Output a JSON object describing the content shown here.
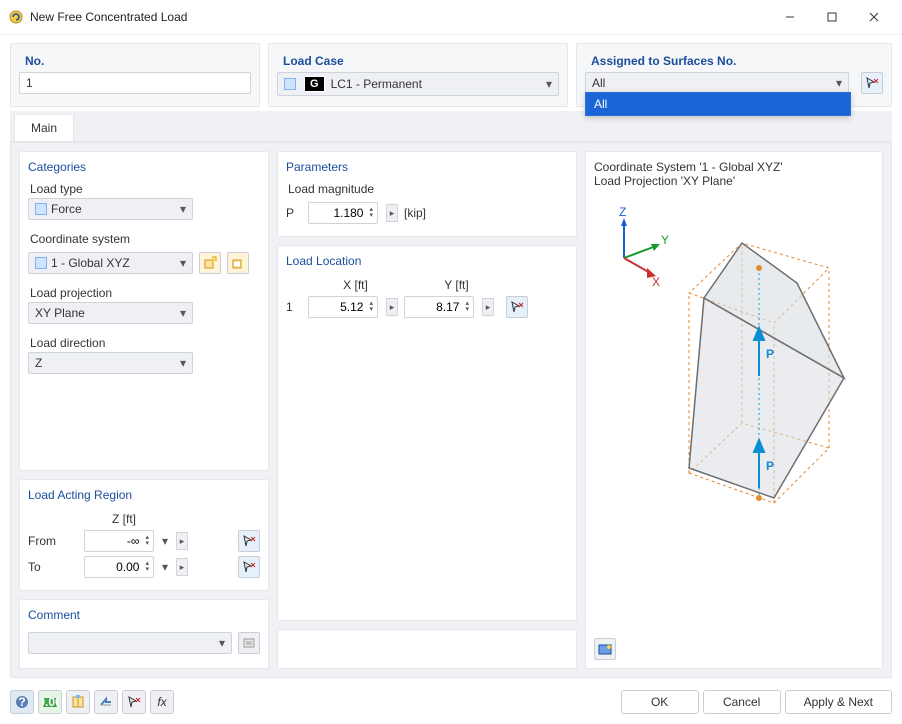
{
  "window": {
    "title": "New Free Concentrated Load"
  },
  "header": {
    "no_label": "No.",
    "no_value": "1",
    "loadcase_label": "Load Case",
    "loadcase_g": "G",
    "loadcase_value": "LC1 - Permanent",
    "assigned_label": "Assigned to Surfaces No.",
    "assigned_value": "All",
    "assigned_options": [
      "All"
    ]
  },
  "tabs": {
    "main": "Main"
  },
  "categories": {
    "title": "Categories",
    "load_type_label": "Load type",
    "load_type_value": "Force",
    "coord_label": "Coordinate system",
    "coord_value": "1 - Global XYZ",
    "proj_label": "Load projection",
    "proj_value": "XY Plane",
    "dir_label": "Load direction",
    "dir_value": "Z"
  },
  "region": {
    "title": "Load Acting Region",
    "zcol": "Z [ft]",
    "from_label": "From",
    "from_value": "-∞",
    "to_label": "To",
    "to_value": "0.00"
  },
  "comment": {
    "title": "Comment",
    "value": ""
  },
  "params": {
    "title": "Parameters",
    "mag_label": "Load magnitude",
    "p_symbol": "P",
    "p_value": "1.180",
    "p_unit": "[kip]"
  },
  "location": {
    "title": "Load Location",
    "xcol": "X [ft]",
    "ycol": "Y [ft]",
    "rownum": "1",
    "x_value": "5.12",
    "y_value": "8.17"
  },
  "preview": {
    "line1": "Coordinate System '1 - Global XYZ'",
    "line2": "Load Projection 'XY Plane'",
    "axis_z": "Z",
    "axis_y": "Y",
    "axis_x": "X",
    "p1": "P",
    "p2": "P"
  },
  "footer": {
    "ok": "OK",
    "cancel": "Cancel",
    "apply": "Apply & Next"
  }
}
